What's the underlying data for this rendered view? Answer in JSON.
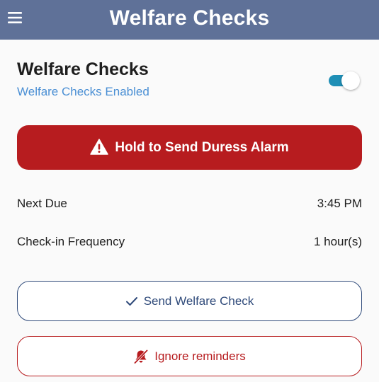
{
  "app_bar": {
    "title": "Welfare Checks",
    "menu_icon": "hamburger-menu-icon",
    "background_color": "#5f7198"
  },
  "welfare": {
    "title": "Welfare Checks",
    "status": "Welfare Checks Enabled",
    "enabled": true,
    "toggle_color": "#1f8fb6"
  },
  "duress": {
    "label": "Hold to Send Duress Alarm",
    "icon": "warning-triangle-icon",
    "color": "#b71c1f"
  },
  "details": [
    {
      "label": "Next Due",
      "value": "3:45 PM"
    },
    {
      "label": "Check-in Frequency",
      "value": "1 hour(s)"
    }
  ],
  "actions": {
    "send_check": {
      "label": "Send Welfare Check",
      "icon": "check-icon",
      "color": "#2f4a7a"
    },
    "ignore": {
      "label": "Ignore reminders",
      "icon": "bell-off-icon",
      "color": "#b71c1f"
    }
  }
}
